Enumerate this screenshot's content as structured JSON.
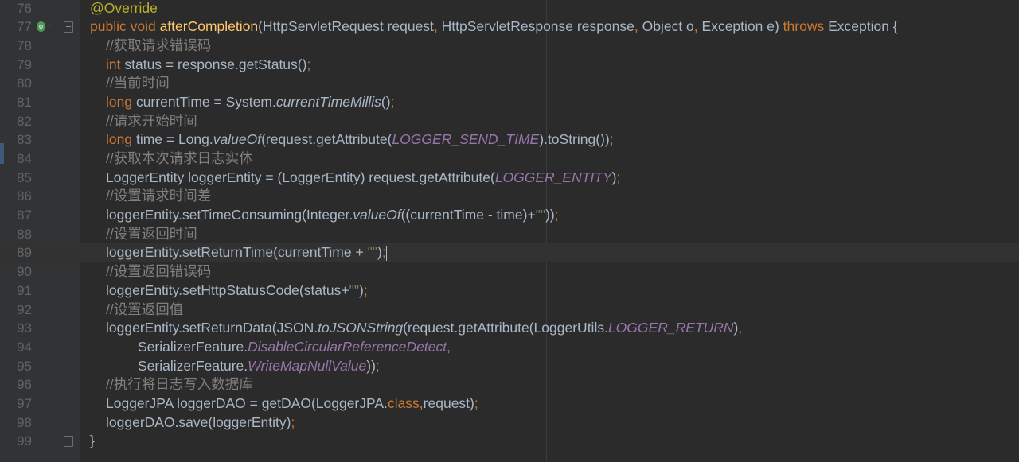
{
  "editor": {
    "partial_top_line": "75",
    "current_line": "89",
    "colors": {
      "background": "#2b2b2b",
      "gutter": "#313335",
      "keyword": "#cc7832",
      "annotation": "#bbb529",
      "method": "#ffc66d",
      "comment": "#808080",
      "static": "#9876aa",
      "text": "#a9b7c6"
    },
    "lines": [
      {
        "n": "76",
        "indent": 0,
        "tokens": [
          [
            "ann",
            "@Override"
          ]
        ]
      },
      {
        "n": "77",
        "indent": 0,
        "tokens": [
          [
            "kw",
            "public void "
          ],
          [
            "fn",
            "afterCompletion"
          ],
          [
            "",
            "(HttpServletRequest request"
          ],
          [
            "kw",
            ", "
          ],
          [
            "",
            "HttpServletResponse response"
          ],
          [
            "kw",
            ", "
          ],
          [
            "",
            "Object o"
          ],
          [
            "kw",
            ", "
          ],
          [
            "",
            "Exception e) "
          ],
          [
            "kw",
            "throws "
          ],
          [
            "",
            "Exception {"
          ]
        ]
      },
      {
        "n": "78",
        "indent": 1,
        "tokens": [
          [
            "cm",
            "//获取请求错误码"
          ]
        ]
      },
      {
        "n": "79",
        "indent": 1,
        "tokens": [
          [
            "kw",
            "int "
          ],
          [
            "",
            "status = response.getStatus()"
          ],
          [
            "kw",
            ";"
          ]
        ]
      },
      {
        "n": "80",
        "indent": 1,
        "tokens": [
          [
            "cm",
            "//当前时间"
          ]
        ]
      },
      {
        "n": "81",
        "indent": 1,
        "tokens": [
          [
            "kw",
            "long "
          ],
          [
            "",
            "currentTime = System."
          ],
          [
            "it",
            "currentTimeMillis"
          ],
          [
            "",
            "()"
          ],
          [
            "kw",
            ";"
          ]
        ]
      },
      {
        "n": "82",
        "indent": 1,
        "tokens": [
          [
            "cm",
            "//请求开始时间"
          ]
        ]
      },
      {
        "n": "83",
        "indent": 1,
        "tokens": [
          [
            "kw",
            "long "
          ],
          [
            "",
            "time = Long."
          ],
          [
            "it",
            "valueOf"
          ],
          [
            "",
            "(request.getAttribute("
          ],
          [
            "st",
            "LOGGER_SEND_TIME"
          ],
          [
            "",
            ").toString())"
          ],
          [
            "kw",
            ";"
          ]
        ]
      },
      {
        "n": "84",
        "indent": 1,
        "tokens": [
          [
            "cm",
            "//获取本次请求日志实体"
          ]
        ]
      },
      {
        "n": "85",
        "indent": 1,
        "tokens": [
          [
            "",
            "LoggerEntity loggerEntity = (LoggerEntity) request.getAttribute("
          ],
          [
            "st",
            "LOGGER_ENTITY"
          ],
          [
            "",
            ")"
          ],
          [
            "kw",
            ";"
          ]
        ]
      },
      {
        "n": "86",
        "indent": 1,
        "tokens": [
          [
            "cm",
            "//设置请求时间差"
          ]
        ]
      },
      {
        "n": "87",
        "indent": 1,
        "tokens": [
          [
            "",
            "loggerEntity.setTimeConsuming(Integer."
          ],
          [
            "it",
            "valueOf"
          ],
          [
            "",
            "((currentTime - time)+"
          ],
          [
            "str",
            "\"\""
          ],
          [
            "",
            "))"
          ],
          [
            "kw",
            ";"
          ]
        ]
      },
      {
        "n": "88",
        "indent": 1,
        "tokens": [
          [
            "cm",
            "//设置返回时间"
          ]
        ]
      },
      {
        "n": "89",
        "indent": 1,
        "tokens": [
          [
            "",
            "loggerEntity.setReturnTime(currentTime + "
          ],
          [
            "str",
            "\"\""
          ],
          [
            "",
            ")"
          ],
          [
            "kw",
            ";"
          ],
          [
            "caret",
            ""
          ]
        ]
      },
      {
        "n": "90",
        "indent": 1,
        "tokens": [
          [
            "cm",
            "//设置返回错误码"
          ]
        ]
      },
      {
        "n": "91",
        "indent": 1,
        "tokens": [
          [
            "",
            "loggerEntity.setHttpStatusCode(status+"
          ],
          [
            "str",
            "\"\""
          ],
          [
            "",
            ")"
          ],
          [
            "kw",
            ";"
          ]
        ]
      },
      {
        "n": "92",
        "indent": 1,
        "tokens": [
          [
            "cm",
            "//设置返回值"
          ]
        ]
      },
      {
        "n": "93",
        "indent": 1,
        "tokens": [
          [
            "",
            "loggerEntity.setReturnData(JSON."
          ],
          [
            "it",
            "toJSONString"
          ],
          [
            "",
            "(request.getAttribute(LoggerUtils."
          ],
          [
            "st",
            "LOGGER_RETURN"
          ],
          [
            "",
            ")"
          ],
          [
            "kw",
            ","
          ]
        ]
      },
      {
        "n": "94",
        "indent": 3,
        "tokens": [
          [
            "",
            "SerializerFeature."
          ],
          [
            "st",
            "DisableCircularReferenceDetect"
          ],
          [
            "kw",
            ","
          ]
        ]
      },
      {
        "n": "95",
        "indent": 3,
        "tokens": [
          [
            "",
            "SerializerFeature."
          ],
          [
            "st",
            "WriteMapNullValue"
          ],
          [
            "",
            "))"
          ],
          [
            "kw",
            ";"
          ]
        ]
      },
      {
        "n": "96",
        "indent": 1,
        "tokens": [
          [
            "cm",
            "//执行将日志写入数据库"
          ]
        ]
      },
      {
        "n": "97",
        "indent": 1,
        "tokens": [
          [
            "",
            "LoggerJPA loggerDAO = getDAO(LoggerJPA."
          ],
          [
            "kw",
            "class,"
          ],
          [
            "",
            "request)"
          ],
          [
            "kw",
            ";"
          ]
        ]
      },
      {
        "n": "98",
        "indent": 1,
        "tokens": [
          [
            "",
            "loggerDAO.save(loggerEntity)"
          ],
          [
            "kw",
            ";"
          ]
        ]
      },
      {
        "n": "99",
        "indent": 0,
        "tokens": [
          [
            "",
            "}"
          ]
        ]
      }
    ]
  }
}
